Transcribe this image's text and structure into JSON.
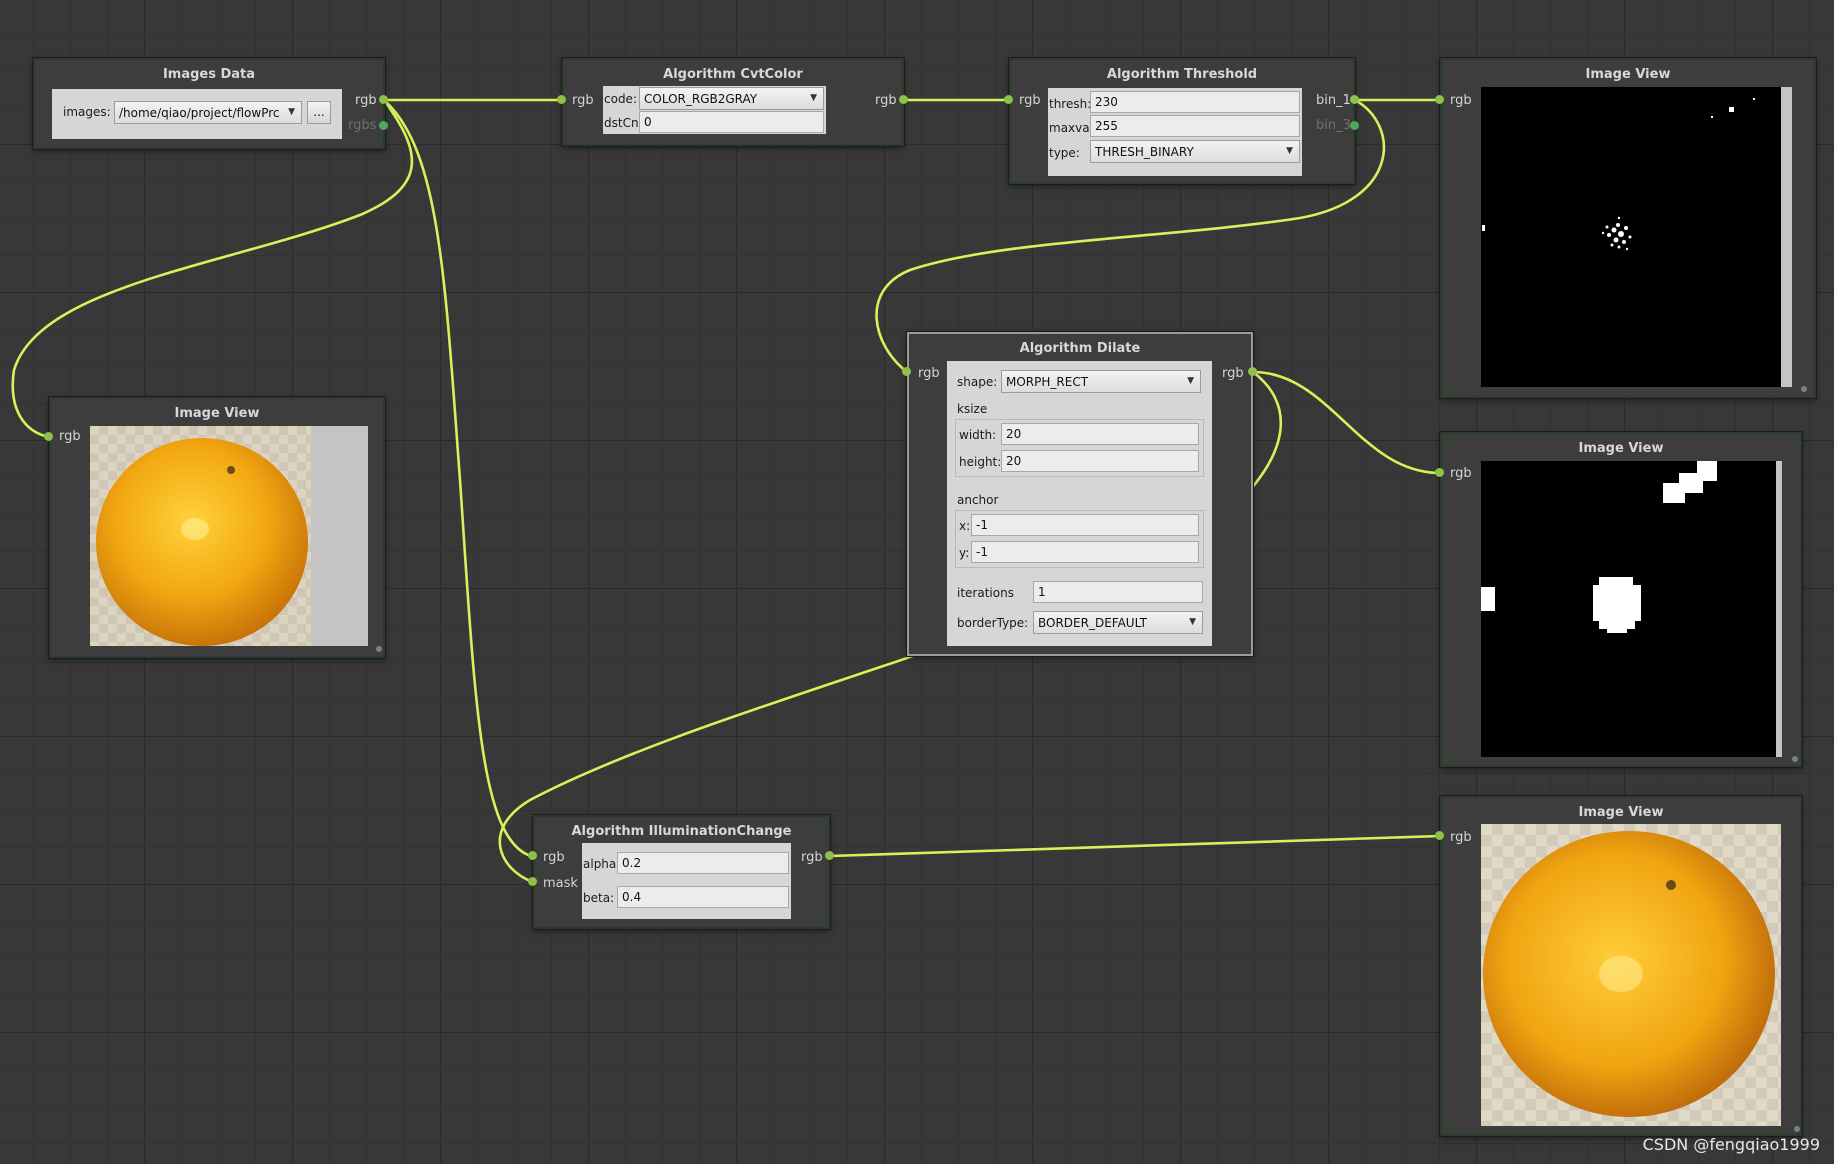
{
  "nodes": {
    "images_data": {
      "title": "Images Data",
      "images_label": "images:",
      "images_value": "/home/qiao/project/flowPrc",
      "browse_label": "...",
      "out_ports": [
        "rgb",
        "rgbs"
      ]
    },
    "cvtcolor": {
      "title": "Algorithm CvtColor",
      "in_port": "rgb",
      "out_port": "rgb",
      "code_label": "code:",
      "code_value": "COLOR_RGB2GRAY",
      "dstcn_label": "dstCn:",
      "dstcn_value": "0"
    },
    "threshold": {
      "title": "Algorithm Threshold",
      "in_port": "rgb",
      "out_ports": [
        "bin_1",
        "bin_3"
      ],
      "thresh_label": "thresh:",
      "thresh_value": "230",
      "maxval_label": "maxval:",
      "maxval_value": "255",
      "type_label": "type:",
      "type_value": "THRESH_BINARY"
    },
    "dilate": {
      "title": "Algorithm Dilate",
      "in_port": "rgb",
      "out_port": "rgb",
      "shape_label": "shape:",
      "shape_value": "MORPH_RECT",
      "ksize_label": "ksize",
      "width_label": "width:",
      "width_value": "20",
      "height_label": "height:",
      "height_value": "20",
      "anchor_label": "anchor",
      "x_label": "x:",
      "x_value": "-1",
      "y_label": "y:",
      "y_value": "-1",
      "iterations_label": "iterations",
      "iterations_value": "1",
      "bordertype_label": "borderType:",
      "bordertype_value": "BORDER_DEFAULT"
    },
    "illumination": {
      "title": "Algorithm IlluminationChange",
      "in_ports": [
        "rgb",
        "mask"
      ],
      "out_port": "rgb",
      "alpha_label": "alpha:",
      "alpha_value": "0.2",
      "beta_label": "beta:",
      "beta_value": "0.4"
    },
    "view_top_right": {
      "title": "Image View",
      "in_port": "rgb",
      "content": "threshold-binary-image"
    },
    "view_left": {
      "title": "Image View",
      "in_port": "rgb",
      "content": "orange-photo"
    },
    "view_mid_right": {
      "title": "Image View",
      "in_port": "rgb",
      "content": "dilated-binary-image"
    },
    "view_bottom_right": {
      "title": "Image View",
      "in_port": "rgb",
      "content": "orange-illumination-changed"
    }
  },
  "connections": [
    {
      "from": "Images Data.rgb",
      "to": "Algorithm CvtColor.rgb"
    },
    {
      "from": "Images Data.rgb",
      "to": "Image View.rgb"
    },
    {
      "from": "Images Data.rgb",
      "to": "Algorithm IlluminationChange.rgb"
    },
    {
      "from": "Algorithm CvtColor.rgb",
      "to": "Algorithm Threshold.rgb"
    },
    {
      "from": "Algorithm Threshold.bin_1",
      "to": "Image View.rgb"
    },
    {
      "from": "Algorithm Threshold.bin_1",
      "to": "Algorithm Dilate.rgb"
    },
    {
      "from": "Algorithm Dilate.rgb",
      "to": "Image View.rgb"
    },
    {
      "from": "Algorithm Dilate.rgb",
      "to": "Algorithm IlluminationChange.mask"
    },
    {
      "from": "Algorithm IlluminationChange.rgb",
      "to": "Image View.rgb"
    }
  ],
  "colors": {
    "wire": "#d6f25a",
    "port": "#8ec04a",
    "background": "#383838",
    "node": "#3c3d3c"
  },
  "watermark": "CSDN @fengqiao1999"
}
